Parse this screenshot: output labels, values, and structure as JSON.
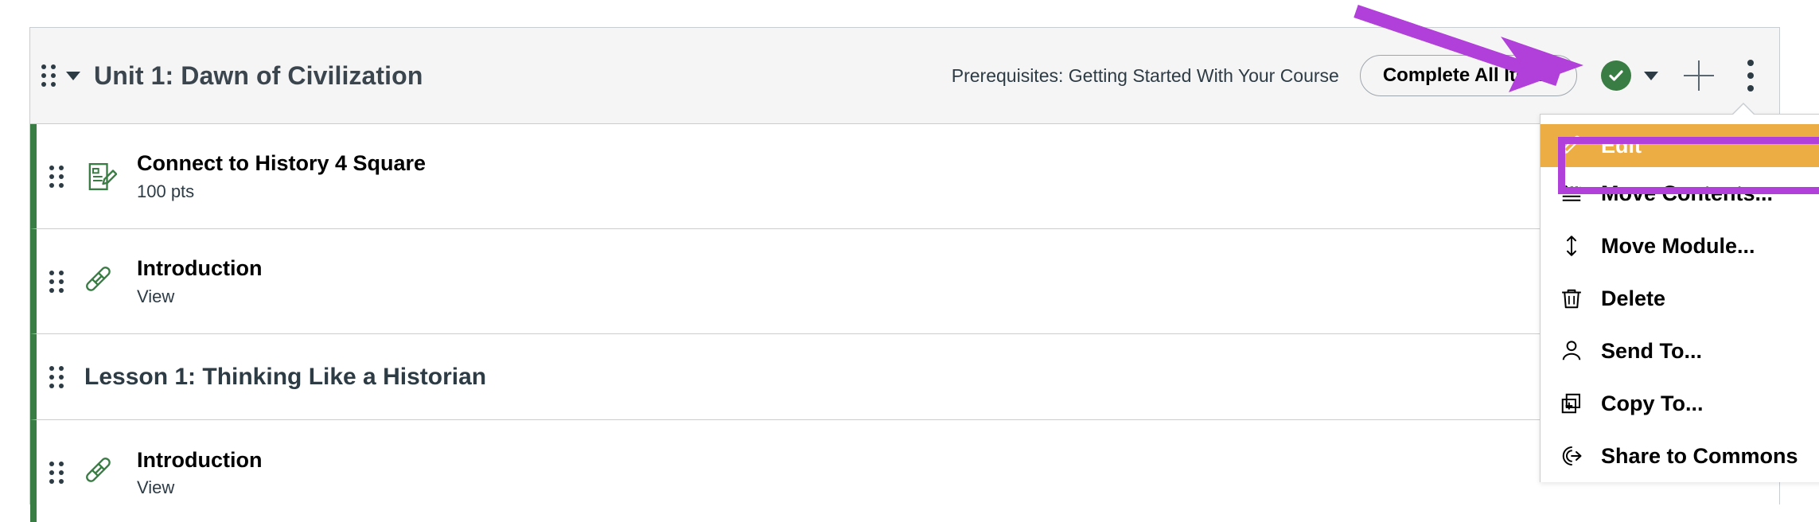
{
  "module": {
    "title": "Unit 1: Dawn of Civilization",
    "drag_handle_icon": "drag-handle-icon",
    "collapse_icon": "caret-down-icon",
    "prerequisites_text": "Prerequisites: Getting Started With Your Course",
    "complete_all_label": "Complete All Items",
    "publish_icon": "published-check-icon",
    "publish_caret_icon": "caret-down-icon",
    "add_icon": "plus-icon",
    "kebab_icon": "kebab-menu-icon",
    "accent_green": "#3a7d44",
    "header_background": "#f5f5f5",
    "border_color": "#c7cdd1"
  },
  "rows": [
    {
      "type": "item",
      "icon": "assignment-icon",
      "title": "Connect to History 4 Square",
      "subtitle": "100 pts"
    },
    {
      "type": "item",
      "icon": "external-link-icon",
      "title": "Introduction",
      "subtitle": "View"
    },
    {
      "type": "subheader",
      "icon": "",
      "title": "Lesson 1: Thinking Like a Historian",
      "subtitle": ""
    },
    {
      "type": "item",
      "icon": "external-link-icon",
      "title": "Introduction",
      "subtitle": "View"
    }
  ],
  "menu": {
    "items": [
      {
        "label": "Edit",
        "icon": "pencil-icon",
        "highlighted": true
      },
      {
        "label": "Move Contents...",
        "icon": "move-contents-icon",
        "highlighted": false
      },
      {
        "label": "Move Module...",
        "icon": "move-updown-icon",
        "highlighted": false
      },
      {
        "label": "Delete",
        "icon": "trash-icon",
        "highlighted": false
      },
      {
        "label": "Send To...",
        "icon": "user-icon",
        "highlighted": false
      },
      {
        "label": "Copy To...",
        "icon": "copy-icon",
        "highlighted": false
      },
      {
        "label": "Share to Commons",
        "icon": "share-commons-icon",
        "highlighted": false
      }
    ],
    "highlight_color": "#b13fd9",
    "selected_background": "#edad45"
  },
  "annotation": {
    "arrow_color": "#b13fd9",
    "arrow_icon": "pointer-arrow-annotation"
  }
}
